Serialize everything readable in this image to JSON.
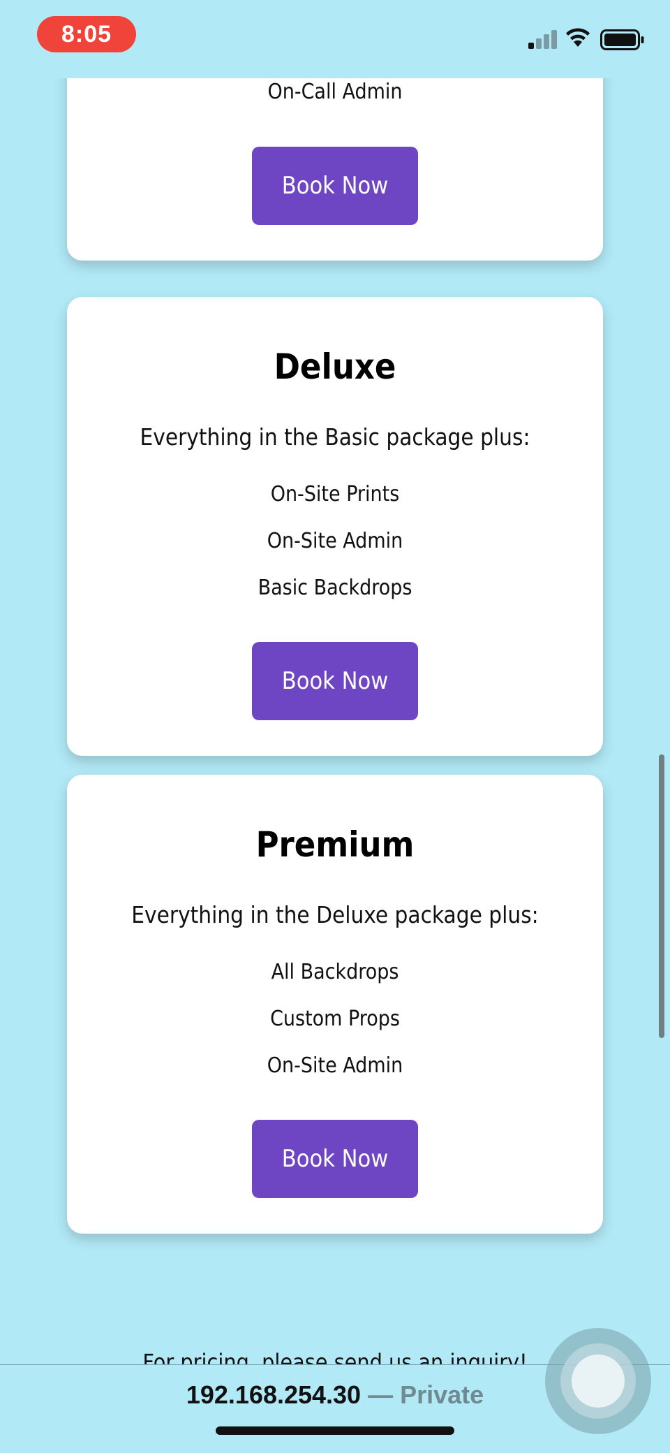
{
  "status_bar": {
    "time": "8:05"
  },
  "cards": [
    {
      "features": [
        "On-Call Admin"
      ],
      "button_label": "Book Now"
    },
    {
      "title": "Deluxe",
      "subtitle": "Everything in the Basic package plus:",
      "features": [
        "On-Site Prints",
        "On-Site Admin",
        "Basic Backdrops"
      ],
      "button_label": "Book Now"
    },
    {
      "title": "Premium",
      "subtitle": "Everything in the Deluxe package plus:",
      "features": [
        "All Backdrops",
        "Custom Props",
        "On-Site Admin"
      ],
      "button_label": "Book Now"
    }
  ],
  "inquiry_text": "For pricing, please send us an inquiry!",
  "browser": {
    "address": "192.168.254.30",
    "privacy": "— Private"
  },
  "colors": {
    "background": "#b2e9f6",
    "button": "#6e45c2",
    "card": "#ffffff"
  }
}
